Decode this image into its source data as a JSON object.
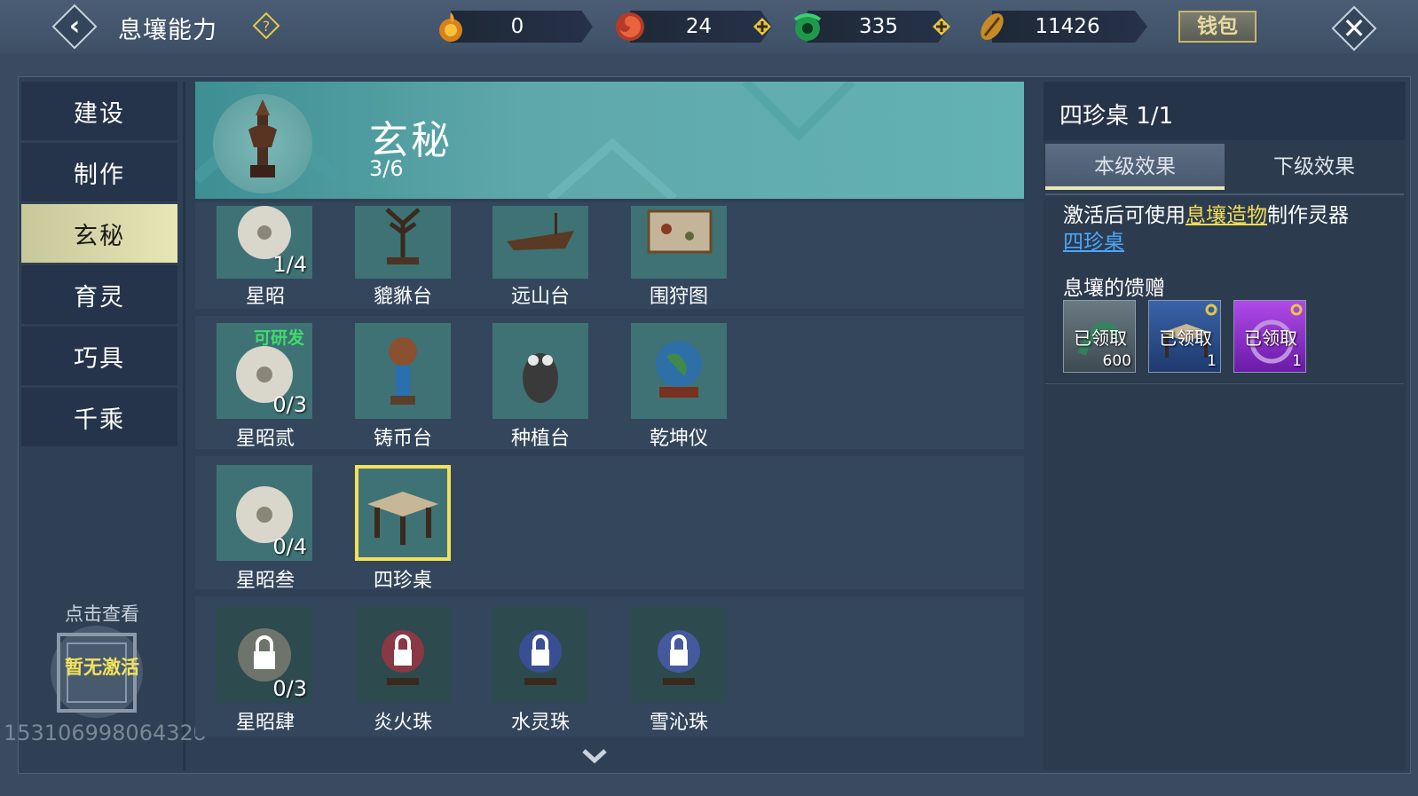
{
  "header": {
    "title": "息壤能力",
    "wallet_label": "钱包",
    "currencies": [
      {
        "icon": "fire-gourd-icon",
        "value": "0"
      },
      {
        "icon": "red-swirl-icon",
        "value": "24"
      },
      {
        "icon": "jade-dragon-icon",
        "value": "335"
      },
      {
        "icon": "gold-shell-icon",
        "value": "11426"
      }
    ]
  },
  "sidebar": {
    "items": [
      {
        "label": "建设"
      },
      {
        "label": "制作"
      },
      {
        "label": "玄秘",
        "active": true
      },
      {
        "label": "育灵"
      },
      {
        "label": "巧具"
      },
      {
        "label": "千乘"
      }
    ],
    "view_hint": "点击查看",
    "stamp_text": "暂无激活",
    "watermark": "15310699806432б"
  },
  "banner": {
    "title": "玄秘",
    "progress": "3/6"
  },
  "grid": {
    "rows": [
      [
        {
          "name": "星昭",
          "count": "1/4",
          "icon": "jade-disc-icon"
        },
        {
          "name": "貔貅台",
          "count": "",
          "icon": "antler-stand-icon"
        },
        {
          "name": "远山台",
          "count": "",
          "icon": "boat-platform-icon"
        },
        {
          "name": "围狩图",
          "count": "",
          "icon": "hunting-map-icon"
        }
      ],
      [
        {
          "name": "星昭贰",
          "count": "0/3",
          "badge": "可研发",
          "icon": "jade-disc-icon"
        },
        {
          "name": "铸币台",
          "count": "",
          "icon": "coin-tower-icon"
        },
        {
          "name": "种植台",
          "count": "",
          "icon": "owl-statue-icon"
        },
        {
          "name": "乾坤仪",
          "count": "",
          "icon": "globe-icon"
        }
      ],
      [
        {
          "name": "星昭叁",
          "count": "0/4",
          "icon": "jade-disc-icon"
        },
        {
          "name": "四珍桌",
          "count": "",
          "icon": "table-icon",
          "selected": true
        }
      ],
      [
        {
          "name": "星昭肆",
          "count": "0/3",
          "icon": "lock-icon",
          "locked": true
        },
        {
          "name": "炎火珠",
          "count": "",
          "icon": "lock-icon",
          "locked": true
        },
        {
          "name": "水灵珠",
          "count": "",
          "icon": "lock-icon",
          "locked": true
        },
        {
          "name": "雪沁珠",
          "count": "",
          "icon": "lock-icon",
          "locked": true
        }
      ]
    ]
  },
  "detail": {
    "title": "四珍桌 1/1",
    "tabs": [
      {
        "label": "本级效果",
        "active": true
      },
      {
        "label": "下级效果"
      }
    ],
    "effect_prefix": "激活后可使用",
    "effect_link": "息壤造物",
    "effect_suffix": "制作灵器",
    "effect_item": "四珍桌",
    "gift_title": "息壤的馈赠",
    "gifts": [
      {
        "status": "已领取",
        "qty": "600",
        "color": "#5b6a72"
      },
      {
        "status": "已领取",
        "qty": "1",
        "color": "#2c4f8a"
      },
      {
        "status": "已领取",
        "qty": "1",
        "color": "#9a35d6"
      }
    ]
  }
}
